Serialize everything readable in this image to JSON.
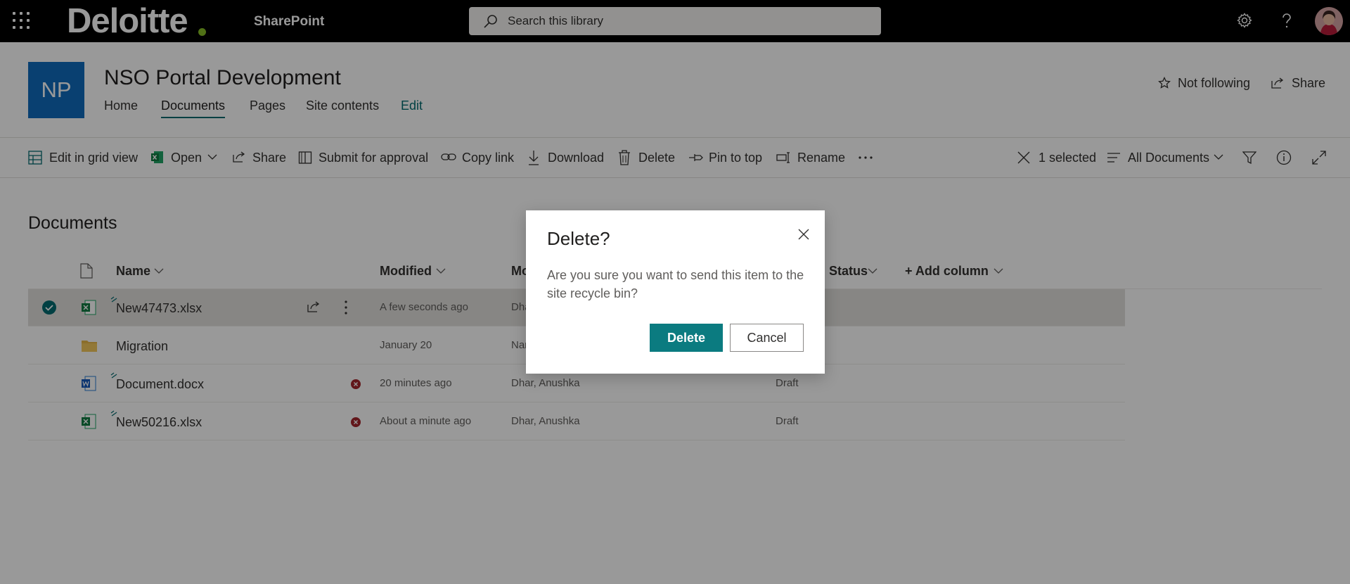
{
  "topbar": {
    "logo_text": "Deloitte",
    "app_name": "SharePoint",
    "search_placeholder": "Search this library"
  },
  "site": {
    "logo_initials": "NP",
    "title": "NSO Portal Development",
    "nav": [
      "Home",
      "Documents",
      "Pages",
      "Site contents",
      "Edit"
    ],
    "active_nav": "Documents",
    "follow_label": "Not following",
    "share_label": "Share"
  },
  "commandbar": {
    "items": [
      "Edit in grid view",
      "Open",
      "Share",
      "Submit for approval",
      "Copy link",
      "Download",
      "Delete",
      "Pin to top",
      "Rename"
    ],
    "selected_count": "1 selected",
    "view_name": "All Documents"
  },
  "library": {
    "title": "Documents",
    "columns": {
      "name": "Name",
      "modified": "Modified",
      "modified_by": "Mo",
      "status": "Status",
      "add_column": "+ Add column"
    },
    "rows": [
      {
        "name": "New47473.xlsx",
        "type": "excel",
        "modified": "A few seconds ago",
        "modified_by": "Dha",
        "status": "",
        "selected": true
      },
      {
        "name": "Migration",
        "type": "folder",
        "modified": "January 20",
        "modified_by": "Nar",
        "status": "",
        "selected": false
      },
      {
        "name": "Document.docx",
        "type": "word",
        "modified": "20 minutes ago",
        "modified_by": "Dhar, Anushka",
        "status": "Draft",
        "selected": false
      },
      {
        "name": "New50216.xlsx",
        "type": "excel",
        "modified": "About a minute ago",
        "modified_by": "Dhar, Anushka",
        "status": "Draft",
        "selected": false
      }
    ]
  },
  "dialog": {
    "title": "Delete?",
    "message": "Are you sure you want to send this item to the site recycle bin?",
    "confirm_label": "Delete",
    "cancel_label": "Cancel"
  },
  "colors": {
    "accent": "#036c70",
    "primary_button": "#0b7b80",
    "site_logo": "#0f6cbd",
    "brand_dot": "#86bc25",
    "error": "#a4262c"
  }
}
